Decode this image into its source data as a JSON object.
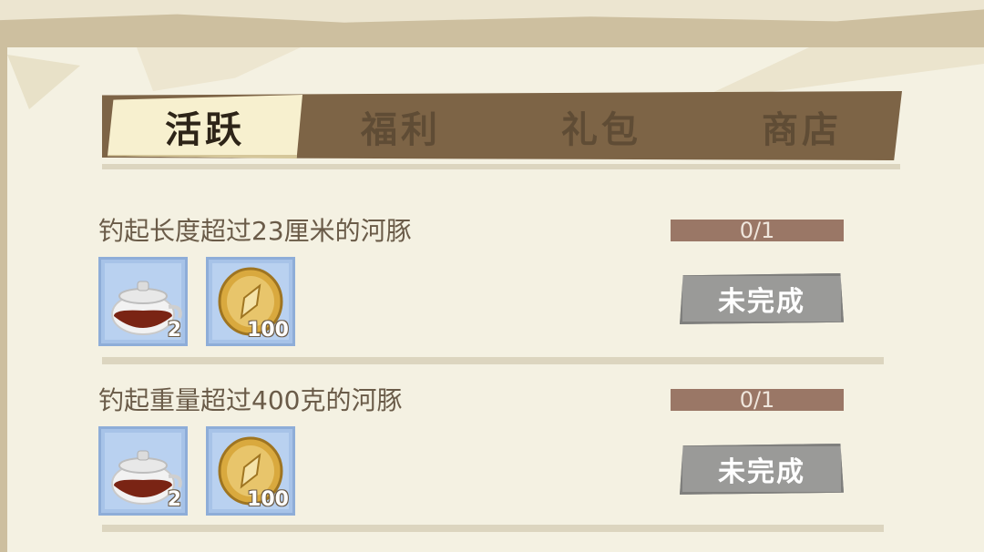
{
  "tabs": [
    {
      "label": "活跃",
      "active": true
    },
    {
      "label": "福利",
      "active": false
    },
    {
      "label": "礼包",
      "active": false
    },
    {
      "label": "商店",
      "active": false
    }
  ],
  "quests": [
    {
      "title": "钓起长度超过23厘米的河豚",
      "progress_text": "0/1",
      "progress": 0.0,
      "status_label": "未完成",
      "rewards": [
        {
          "icon": "teapot-icon",
          "quantity": "2"
        },
        {
          "icon": "gold-coin-icon",
          "quantity": "100"
        }
      ]
    },
    {
      "title": "钓起重量超过400克的河豚",
      "progress_text": "0/1",
      "progress": 0.0,
      "status_label": "未完成",
      "rewards": [
        {
          "icon": "teapot-icon",
          "quantity": "2"
        },
        {
          "icon": "gold-coin-icon",
          "quantity": "100"
        }
      ]
    }
  ],
  "colors": {
    "tab_bar": "#7d6446",
    "active_tab": "#f7f0cf",
    "progress_bar": "#9a7766",
    "reward_bg": "#a7c3e8",
    "status_button": "#9a9a98"
  }
}
